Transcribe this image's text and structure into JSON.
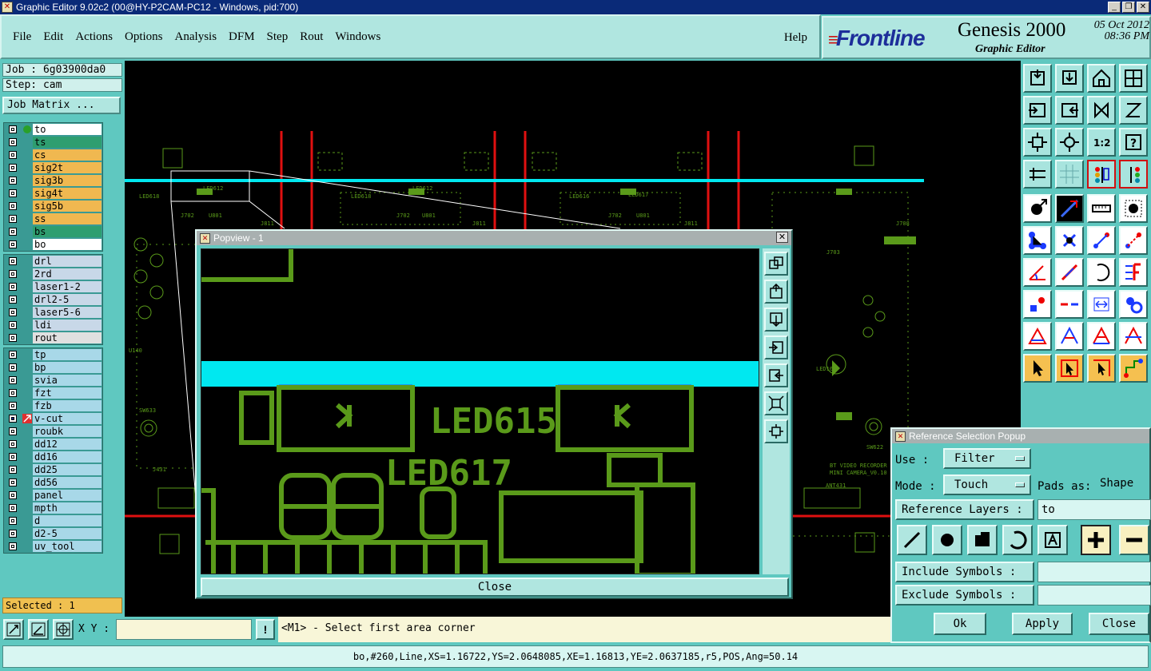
{
  "window": {
    "title": "Graphic Editor 9.02c2 (00@HY-P2CAM-PC12 - Windows, pid:700)"
  },
  "menu": {
    "items": [
      "File",
      "Edit",
      "Actions",
      "Options",
      "Analysis",
      "DFM",
      "Step",
      "Rout",
      "Windows"
    ],
    "help": "Help"
  },
  "brand": {
    "logo": "Frontline",
    "product": "Genesis 2000",
    "subtitle": "Graphic Editor",
    "date": "05 Oct 2012",
    "time": "08:36 PM"
  },
  "job": {
    "job_label": "Job : 6g03900da0",
    "step_label": "Step: cam",
    "matrix_button": "Job Matrix ..."
  },
  "layers": {
    "group1": [
      {
        "name": "to",
        "color": "#ffffff",
        "active": true
      },
      {
        "name": "ts",
        "color": "#2e9e70"
      },
      {
        "name": "cs",
        "color": "#f0b850"
      },
      {
        "name": "sig2t",
        "color": "#f0b850"
      },
      {
        "name": "sig3b",
        "color": "#f0b850"
      },
      {
        "name": "sig4t",
        "color": "#f0b850"
      },
      {
        "name": "sig5b",
        "color": "#f0b850"
      },
      {
        "name": "ss",
        "color": "#f0b850"
      },
      {
        "name": "bs",
        "color": "#2e9e70"
      },
      {
        "name": "bo",
        "color": "#ffffff"
      }
    ],
    "group2": [
      {
        "name": "drl",
        "color": "#c8d8e8"
      },
      {
        "name": "2rd",
        "color": "#c8d8e8"
      },
      {
        "name": "laser1-2",
        "color": "#c8d8e8"
      },
      {
        "name": "drl2-5",
        "color": "#c8d8e8"
      },
      {
        "name": "laser5-6",
        "color": "#c8d8e8"
      },
      {
        "name": "ldi",
        "color": "#c8d8e8"
      },
      {
        "name": "rout",
        "color": "#e0e0e0"
      }
    ],
    "group3": [
      {
        "name": "tp",
        "color": "#a8d8e8"
      },
      {
        "name": "bp",
        "color": "#a8d8e8"
      },
      {
        "name": "svia",
        "color": "#a8d8e8"
      },
      {
        "name": "fzt",
        "color": "#a8d8e8"
      },
      {
        "name": "fzb",
        "color": "#a8d8e8"
      },
      {
        "name": "v-cut",
        "color": "#a8d8e8",
        "highlight": true
      },
      {
        "name": "roubk",
        "color": "#a8d8e8"
      },
      {
        "name": "dd12",
        "color": "#a8d8e8"
      },
      {
        "name": "dd16",
        "color": "#a8d8e8"
      },
      {
        "name": "dd25",
        "color": "#a8d8e8"
      },
      {
        "name": "dd56",
        "color": "#a8d8e8"
      },
      {
        "name": "panel",
        "color": "#a8d8e8"
      },
      {
        "name": "mpth",
        "color": "#a8d8e8"
      },
      {
        "name": "d",
        "color": "#a8d8e8"
      },
      {
        "name": "d2-5",
        "color": "#a8d8e8"
      },
      {
        "name": "uv_tool",
        "color": "#a8d8e8"
      }
    ]
  },
  "selected": "Selected : 1",
  "canvas": {
    "board_labels": [
      "LED618",
      "LED612",
      "LED618",
      "LED612",
      "LED616",
      "LED617",
      "J702",
      "U801",
      "J811",
      "J702",
      "U801",
      "J811",
      "J702",
      "U801",
      "J811",
      "J703",
      "J708",
      "U140",
      "LED16",
      "SW633",
      "SW622",
      "J431",
      "ANT431",
      "BT VIDEO RECORDER",
      "MINI CAMERA_V0.10"
    ]
  },
  "popview": {
    "title": "Popview - 1",
    "labels": [
      "LED615",
      "LED617"
    ],
    "close_button": "Close"
  },
  "refpopup": {
    "title": "Reference Selection Popup",
    "use_label": "Use",
    "use_value": "Filter",
    "mode_label": "Mode",
    "mode_value": "Touch",
    "pads_label": "Pads as:",
    "pads_value": "Shape",
    "ref_layers_label": "Reference Layers :",
    "ref_layers_value": "to",
    "include_label": "Include Symbols :",
    "include_value": "",
    "exclude_label": "Exclude Symbols :",
    "exclude_value": "",
    "ok": "Ok",
    "apply": "Apply",
    "close": "Close"
  },
  "bottom": {
    "xy_label": "X Y :",
    "xy_value": "",
    "excl": "!",
    "prompt": "<M1> - Select first area corner"
  },
  "status": {
    "text": "bo,#260,Line,XS=1.16722,YS=2.0648085,XE=1.16813,YE=2.0637185,r5,POS,Ang=50.14"
  },
  "colors": {
    "panel_bg": "#5fc8c0",
    "board_green": "#5a9a1a",
    "highlight_cyan": "#00e8f0",
    "route_red": "#e01010",
    "title_blue": "#0a2a78"
  }
}
